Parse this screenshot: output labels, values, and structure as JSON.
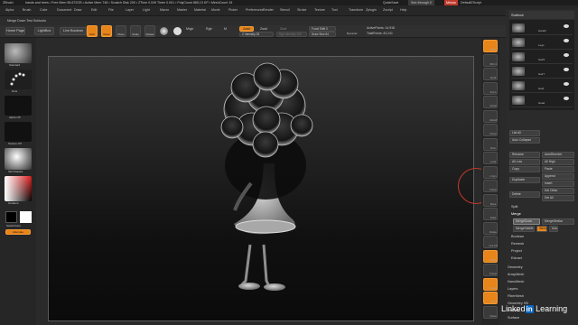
{
  "titlebar": {
    "app_name": "ZBrush",
    "memory_info": "hands and trees  • Free Mem 56.672GB • Active Mem 748 • Scratch Disk 200 • ZTime 0.049 Timer 0.001 • PolyCount 885,13 KP • MeshCount 15",
    "quicksave": "QuickSave",
    "see_through": "See-through 0",
    "menus_btn": "Menus",
    "default_script": "DefaultZScript"
  },
  "menubar": {
    "items": [
      "Alpha",
      "Brush",
      "Color",
      "Document",
      "Draw",
      "Edit",
      "File",
      "Layer",
      "Light",
      "Macro",
      "Marker",
      "Material",
      "Movie",
      "Picker",
      "Preferences",
      "Render",
      "Stencil",
      "Stroke",
      "Texture",
      "Tool",
      "Transform",
      "Zplugin",
      "Zscript",
      "Help"
    ]
  },
  "statusbar": {
    "hint": "Merge Down Test Subtools"
  },
  "shelf": {
    "home_page": "Home Page",
    "lightbox": "LightBox",
    "live_boolean": "Live Boolean",
    "edit": "Edit",
    "draw": "Draw",
    "move": "Move",
    "scale": "Scale",
    "rotate": "Rotate",
    "mrgb": "Mrgb",
    "rgb": "Rgb",
    "m": "M",
    "zadd": "Zadd",
    "zsub": "Zsub",
    "zcut": "Zcut",
    "z_intensity": "Z Intensity 25",
    "rgb_intensity": "Rgb Intensity 100",
    "focal_shift": "Focal Shift 0",
    "draw_size": "Draw Size 64",
    "dynamic": "Dynamic",
    "active_points": "ActivePoints: 14,918",
    "total_points": "TotalPoints: 81,241"
  },
  "leftpanel": {
    "brush1": "Standard",
    "brush2": "Dots",
    "alpha": "Alpha Off",
    "texture": "Texture Off",
    "material": "SkinShade4",
    "gradient": "Gradient",
    "switch_color": "SwitchColor",
    "alternate": "Alternate"
  },
  "rightshelf": {
    "items": [
      "BPR",
      "SPix 3",
      "Scroll",
      "Zoom",
      "Actual",
      "AAHalf",
      "Persp",
      "Floor",
      "Local",
      "L.Sym",
      "Frame",
      "Move",
      "Scale",
      "Rotate",
      "Line Fill",
      "PolyF",
      "Transp",
      "Ghost",
      "Solo",
      "Xpose"
    ]
  },
  "toolpanel": {
    "subtool_header": "Subtool",
    "subtools": [
      "Hand2",
      "Legs",
      "Hair5",
      "Hair7",
      "Hat1",
      "Head"
    ],
    "list_all": "List All",
    "auto_collapse": "Auto Collapse",
    "rename": "Rename",
    "auto_reorder": "AutoReorder",
    "all_low": "All Low",
    "all_high": "All High",
    "copy": "Copy",
    "paste": "Paste",
    "duplicate": "Duplicate",
    "append": "Append",
    "insert": "Insert",
    "delete": "Delete",
    "del_other": "Del Other",
    "del_all": "Del All",
    "split": "Split",
    "merge": "Merge",
    "merge_down": "MergeDown",
    "merge_similar": "MergeSimilar",
    "merge_visible": "MergeVisible",
    "weld": "Weld",
    "uvs": "Uvs",
    "boolean": "Boolean",
    "remesh": "Remesh",
    "project": "Project",
    "extract": "Extract",
    "geometry": "Geometry",
    "array_mesh": "ArrayMesh",
    "nano_mesh": "NanoMesh",
    "layers": "Layers",
    "fiber_mesh": "FiberMesh",
    "geometry_hd": "Geometry HD",
    "preview": "Preview",
    "surface": "Surface"
  },
  "watermark": {
    "linked": "Linked",
    "in": "in",
    "learning": "Learning"
  },
  "colors": {
    "accent": "#e8851a",
    "bg": "#2a2a2a",
    "viewport_top": "#363636",
    "viewport_bottom": "#0b0b0b"
  }
}
